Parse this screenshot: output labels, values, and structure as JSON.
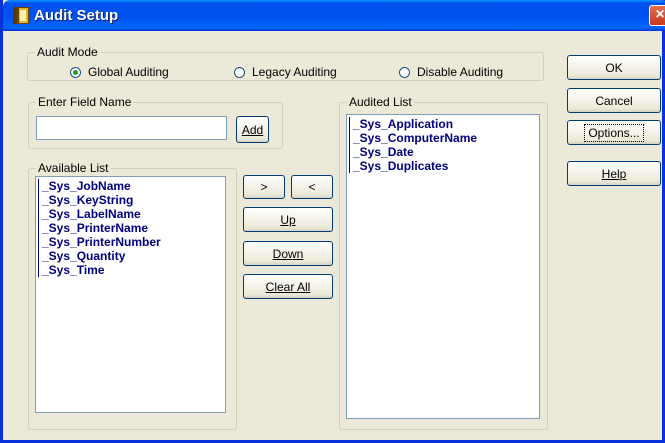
{
  "window": {
    "title": "Audit Setup",
    "close_label": "×"
  },
  "audit_mode": {
    "legend": "Audit Mode",
    "options": [
      {
        "label": "Global Auditing",
        "checked": true
      },
      {
        "label": "Legacy Auditing",
        "checked": false
      },
      {
        "label": "Disable Auditing",
        "checked": false
      }
    ]
  },
  "enter_field": {
    "legend": "Enter Field Name",
    "value": "",
    "add_label": "Add"
  },
  "available_list": {
    "legend": "Available List",
    "items": [
      "_Sys_JobName",
      "_Sys_KeyString",
      "_Sys_LabelName",
      "_Sys_PrinterName",
      "_Sys_PrinterNumber",
      "_Sys_Quantity",
      "_Sys_Time"
    ]
  },
  "audited_list": {
    "legend": "Audited List",
    "items": [
      "_Sys_Application",
      "_Sys_ComputerName",
      "_Sys_Date",
      "_Sys_Duplicates"
    ]
  },
  "middle_buttons": {
    "move_right": ">",
    "move_left": "<",
    "up": "Up",
    "down": "Down",
    "clear_all": "Clear All"
  },
  "dialog_buttons": {
    "ok": "OK",
    "cancel": "Cancel",
    "options": "Options...",
    "help": "Help"
  }
}
